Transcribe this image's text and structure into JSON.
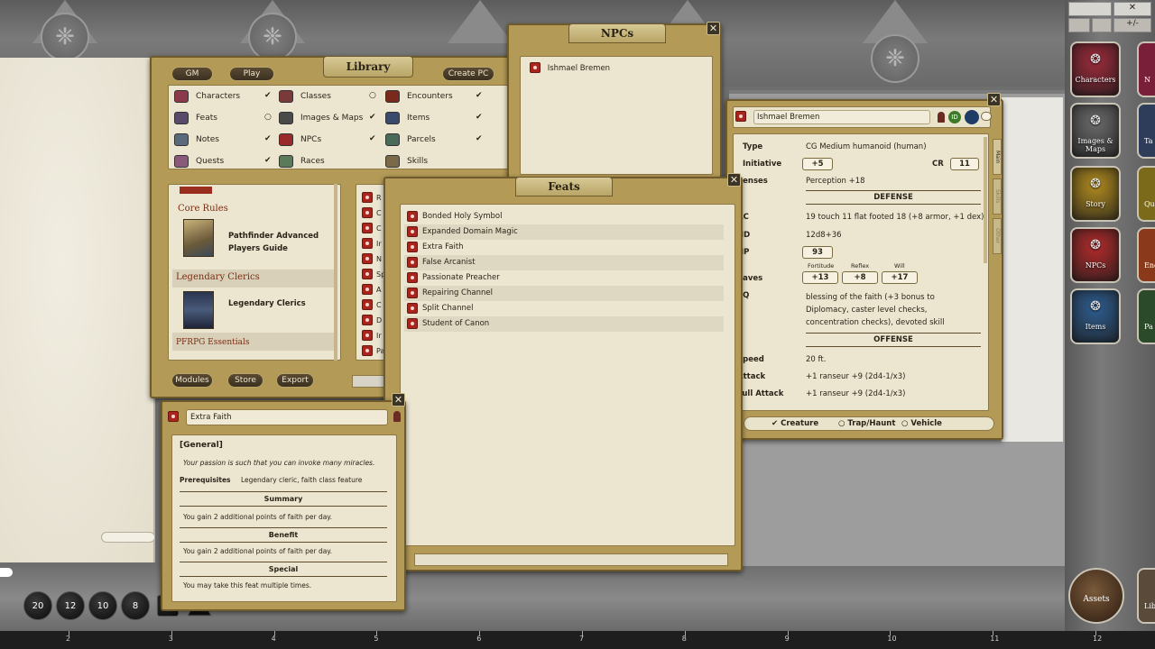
{
  "library": {
    "title": "Library",
    "gm_label": "GM",
    "play_label": "Play",
    "create_pc_label": "Create PC",
    "categories": [
      {
        "label": "Characters",
        "mark": "✔"
      },
      {
        "label": "Classes",
        "mark": "○"
      },
      {
        "label": "Encounters",
        "mark": "✔"
      },
      {
        "label": "Feats",
        "mark": "○"
      },
      {
        "label": "Images & Maps",
        "mark": "✔"
      },
      {
        "label": "Items",
        "mark": "✔"
      },
      {
        "label": "Notes",
        "mark": "✔"
      },
      {
        "label": "NPCs",
        "mark": "✔"
      },
      {
        "label": "Parcels",
        "mark": "✔"
      },
      {
        "label": "Quests",
        "mark": "✔"
      },
      {
        "label": "Races",
        "mark": ""
      },
      {
        "label": "Skills",
        "mark": ""
      }
    ],
    "modules": [
      {
        "group": "Core Rules",
        "book": "Pathfinder Advanced Players Guide"
      },
      {
        "group": "Legendary Clerics",
        "book": "Legendary Clerics"
      },
      {
        "group": "PFRPG Essentials",
        "book": ""
      }
    ],
    "modules_label": "Modules",
    "store_label": "Store",
    "export_label": "Export",
    "right_col_letters": [
      "R",
      "C",
      "C",
      "Ir",
      "N",
      "Sp",
      "A",
      "C",
      "D",
      "Ir",
      "Pa"
    ]
  },
  "npcs": {
    "title": "NPCs",
    "items": [
      "Ishmael Bremen"
    ]
  },
  "feats": {
    "title": "Feats",
    "items": [
      "Bonded Holy Symbol",
      "Expanded Domain Magic",
      "Extra Faith",
      "False Arcanist",
      "Passionate Preacher",
      "Repairing Channel",
      "Split Channel",
      "Student of Canon"
    ]
  },
  "feat_detail": {
    "name": "Extra Faith",
    "type": "[General]",
    "flavor": "Your passion is such that you can invoke many miracles.",
    "prereq_label": "Prerequisites",
    "prereq_value": "Legendary cleric, faith class feature",
    "summary_head": "Summary",
    "summary_text": "You gain 2 additional points of faith per day.",
    "benefit_head": "Benefit",
    "benefit_text": "You gain 2 additional points of faith per day.",
    "special_head": "Special",
    "special_text": "You may take this feat multiple times."
  },
  "npc_sheet": {
    "name": "Ishmael Bremen",
    "side_tabs": [
      "Main",
      "Skills",
      "Other"
    ],
    "type_label": "Type",
    "type_value": "CG Medium humanoid (human)",
    "init_label": "Initiative",
    "init_value": "+5",
    "cr_label": "CR",
    "cr_value": "11",
    "senses_label": "Senses",
    "senses_value": "Perception +18",
    "defense_head": "DEFENSE",
    "ac_label": "AC",
    "ac_value": "19 touch 11 flat footed 18 (+8 armor, +1 dex)",
    "hd_label": "HD",
    "hd_value": "12d8+36",
    "hp_label": "HP",
    "hp_value": "93",
    "saves_label": "Saves",
    "fort_label": "Fortitude",
    "fort_value": "+13",
    "ref_label": "Reflex",
    "ref_value": "+8",
    "will_label": "Will",
    "will_value": "+17",
    "sq_label": "SQ",
    "sq_value": "blessing of the faith (+3 bonus to Diplomacy, caster level checks, concentration checks), devoted skill",
    "offense_head": "OFFENSE",
    "speed_label": "Speed",
    "speed_value": "20 ft.",
    "attack_label": "Attack",
    "attack_value": "+1 ranseur +9 (2d4-1/x3)",
    "full_attack_label": "Full Attack",
    "full_attack_value": "+1 ranseur +9 (2d4-1/x3)",
    "kind_creature": "Creature",
    "kind_trap": "Trap/Haunt",
    "kind_vehicle": "Vehicle"
  },
  "sidebar": {
    "buttons": [
      {
        "label": "Characters",
        "color": "#9b2a3a"
      },
      {
        "label": "Images & Maps",
        "color": "#6a6a6a"
      },
      {
        "label": "Story",
        "color": "#b08a1e"
      },
      {
        "label": "NPCs",
        "color": "#b02a2a"
      },
      {
        "label": "Items",
        "color": "#2d5c8e"
      }
    ],
    "stubs": [
      "N",
      "Ta",
      "Qu",
      "Enco",
      "Pa"
    ],
    "assets_label": "Assets",
    "lib_label": "Lib"
  },
  "dice": [
    "20",
    "12",
    "10",
    "8",
    "6"
  ],
  "ruler_labels": [
    "2",
    "3",
    "4",
    "5",
    "6",
    "7",
    "8",
    "9",
    "10",
    "11",
    "12"
  ]
}
